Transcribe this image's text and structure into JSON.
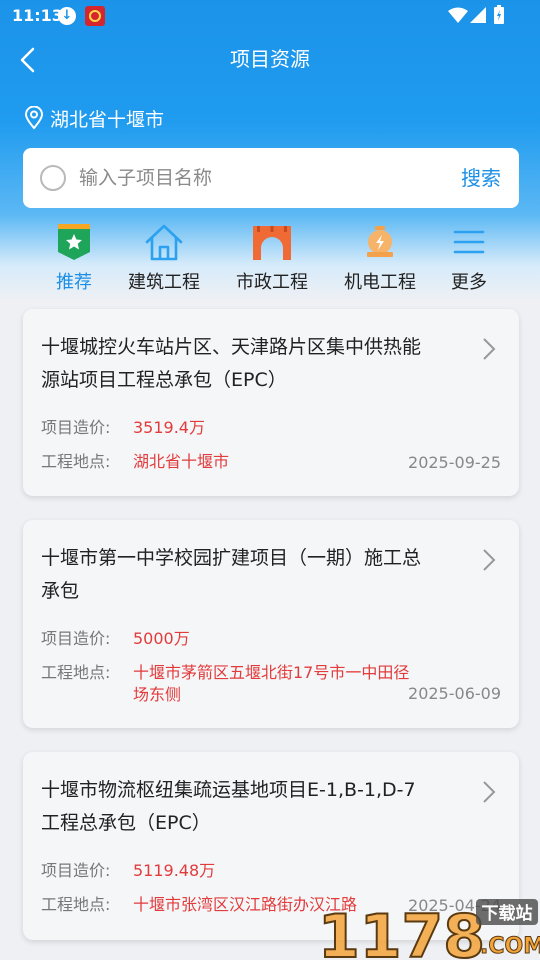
{
  "status_bar": {
    "time": "11:13"
  },
  "nav": {
    "title": "项目资源"
  },
  "location": "湖北省十堰市",
  "search": {
    "placeholder": "输入子项目名称",
    "button": "搜索"
  },
  "categories": [
    {
      "label": "推荐",
      "icon": "recommend-shield-icon",
      "active": true
    },
    {
      "label": "建筑工程",
      "icon": "house-icon",
      "active": false
    },
    {
      "label": "市政工程",
      "icon": "bridge-icon",
      "active": false
    },
    {
      "label": "机电工程",
      "icon": "motor-icon",
      "active": false
    },
    {
      "label": "更多",
      "icon": "menu-icon",
      "active": false
    }
  ],
  "projects": [
    {
      "title": "十堰城控火车站片区、天津路片区集中供热能源站项目工程总承包（EPC）",
      "cost_label": "项目造价:",
      "cost": "3519.4万",
      "location_label": "工程地点:",
      "location": "湖北省十堰市",
      "date": "2025-09-25"
    },
    {
      "title": "十堰市第一中学校园扩建项目（一期）施工总承包",
      "cost_label": "项目造价:",
      "cost": "5000万",
      "location_label": "工程地点:",
      "location": "十堰市茅箭区五堰北街17号市一中田径场东侧",
      "date": "2025-06-09"
    },
    {
      "title": "十堰市物流枢纽集疏运基地项目E-1,B-1,D-7工程总承包（EPC）",
      "cost_label": "项目造价:",
      "cost": "5119.48万",
      "location_label": "工程地点:",
      "location": "十堰市张湾区汉江路街办汉江路",
      "date": "2025-04-24"
    }
  ],
  "watermark": {
    "number": "1178",
    "site": "下载站",
    "domain": ".COM"
  },
  "colors": {
    "primary": "#1b93e9",
    "accent_red": "#e23b3b",
    "active_tab": "#1b8fe6"
  }
}
